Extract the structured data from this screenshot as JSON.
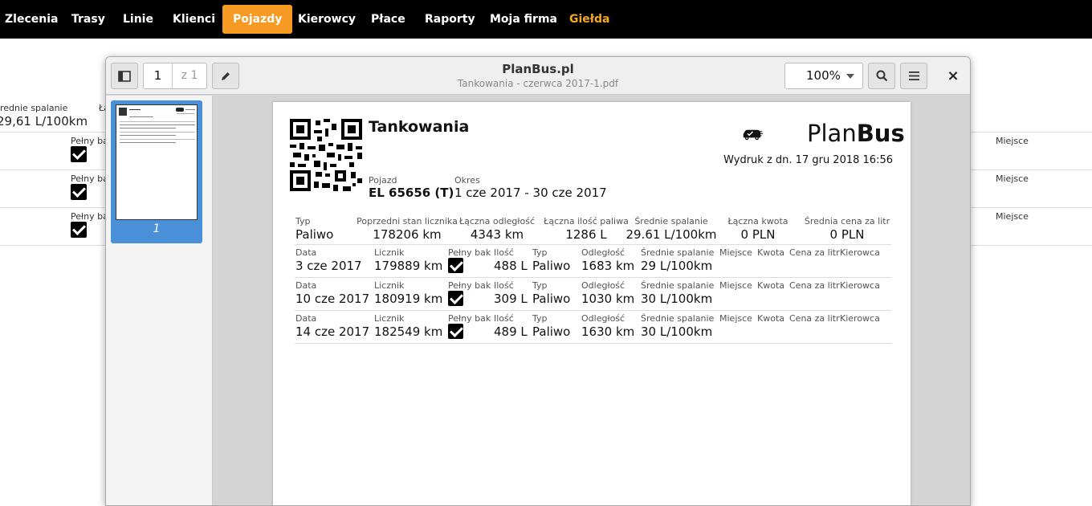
{
  "nav": {
    "items": [
      "Zlecenia",
      "Trasy",
      "Linie",
      "Klienci",
      "Pojazdy",
      "Kierowcy",
      "Płace",
      "Raporty",
      "Moja firma",
      "Giełda"
    ],
    "active": "Pojazdy"
  },
  "background": {
    "avg_label": "rednie spalanie",
    "avg_value": "29,61 L/100km",
    "cut_label": "Ła",
    "full_tank": "Pełny bak",
    "place": "Miejsce"
  },
  "viewer": {
    "title": "PlanBus.pl",
    "filename": "Tankowania - czerwca 2017-1.pdf",
    "page_current": "1",
    "page_total": "z 1",
    "zoom": "100%",
    "close": "×",
    "thumb_number": "1"
  },
  "document": {
    "title": "Tankowania",
    "logo_plan": "Plan",
    "logo_bus": "Bus",
    "printed_at": "Wydruk z dn. 17 gru 2018 16:56",
    "vehicle_label": "Pojazd",
    "vehicle_value": "EL 65656 (T)",
    "period_label": "Okres",
    "period_value": "1 cze 2017 - 30 cze 2017",
    "summary": {
      "labels": [
        "Typ",
        "Poprzedni stan licznika",
        "Łączna odległość",
        "Łączna ilość paliwa",
        "Średnie spalanie",
        "Łączna kwota",
        "Średnia cena za litr"
      ],
      "values": [
        "Paliwo",
        "178206 km",
        "4343 km",
        "1286 L",
        "29.61 L/100km",
        "0 PLN",
        "0 PLN"
      ]
    },
    "row_labels": [
      "Data",
      "Licznik",
      "Pełny bak",
      "Ilość",
      "Typ",
      "Odległość",
      "Średnie spalanie",
      "Miejsce",
      "Kwota",
      "Cena za litr",
      "Kierowca"
    ],
    "rows": [
      {
        "date": "3 cze 2017",
        "odometer": "179889 km",
        "qty": "488 L",
        "type": "Paliwo",
        "distance": "1683 km",
        "avg": "29 L/100km"
      },
      {
        "date": "10 cze 2017",
        "odometer": "180919 km",
        "qty": "309 L",
        "type": "Paliwo",
        "distance": "1030 km",
        "avg": "30 L/100km"
      },
      {
        "date": "14 cze 2017",
        "odometer": "182549 km",
        "qty": "489 L",
        "type": "Paliwo",
        "distance": "1630 km",
        "avg": "30 L/100km"
      }
    ]
  }
}
